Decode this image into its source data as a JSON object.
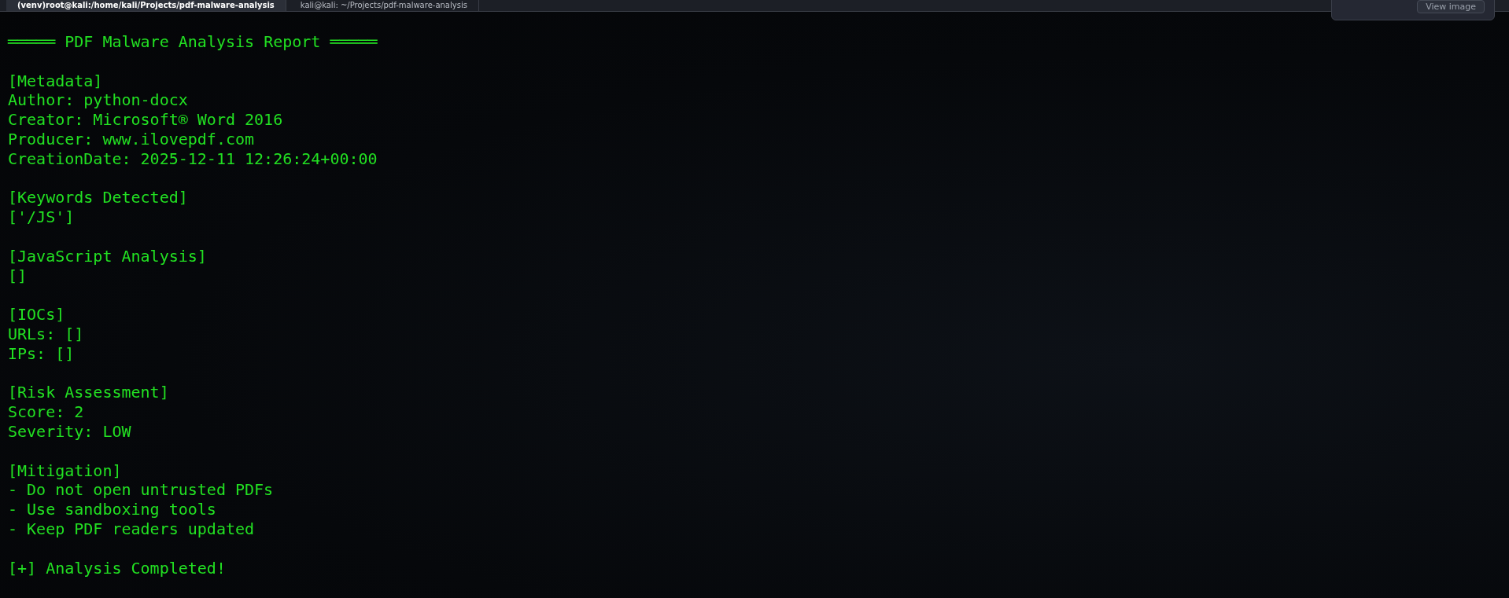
{
  "tabs": [
    {
      "label": "(venv)root@kali:/home/kali/Projects/pdf-malware-analysis",
      "selected": true
    },
    {
      "label": "kali@kali: ~/Projects/pdf-malware-analysis",
      "selected": false
    }
  ],
  "notification": {
    "button": "View image"
  },
  "terminal": {
    "lines": [
      {
        "kind": "title",
        "text": "PDF Malware Analysis Report",
        "rule": "═════"
      },
      {
        "kind": "blank"
      },
      {
        "kind": "text",
        "text": "[Metadata]"
      },
      {
        "kind": "text",
        "text": "Author: python-docx"
      },
      {
        "kind": "text",
        "text": "Creator: Microsoft® Word 2016"
      },
      {
        "kind": "text",
        "text": "Producer: www.ilovepdf.com"
      },
      {
        "kind": "text",
        "text": "CreationDate: 2025-12-11 12:26:24+00:00"
      },
      {
        "kind": "blank"
      },
      {
        "kind": "text",
        "text": "[Keywords Detected]"
      },
      {
        "kind": "text",
        "text": "['/JS']"
      },
      {
        "kind": "blank"
      },
      {
        "kind": "text",
        "text": "[JavaScript Analysis]"
      },
      {
        "kind": "text",
        "text": "[]"
      },
      {
        "kind": "blank"
      },
      {
        "kind": "text",
        "text": "[IOCs]"
      },
      {
        "kind": "text",
        "text": "URLs: []"
      },
      {
        "kind": "text",
        "text": "IPs: []"
      },
      {
        "kind": "blank"
      },
      {
        "kind": "text",
        "text": "[Risk Assessment]"
      },
      {
        "kind": "text",
        "text": "Score: 2"
      },
      {
        "kind": "text",
        "text": "Severity: LOW"
      },
      {
        "kind": "blank"
      },
      {
        "kind": "text",
        "text": "[Mitigation]"
      },
      {
        "kind": "text",
        "text": "- Do not open untrusted PDFs"
      },
      {
        "kind": "text",
        "text": "- Use sandboxing tools"
      },
      {
        "kind": "text",
        "text": "- Keep PDF readers updated"
      },
      {
        "kind": "blank"
      },
      {
        "kind": "text",
        "text": "[+] Analysis Completed!"
      }
    ]
  }
}
